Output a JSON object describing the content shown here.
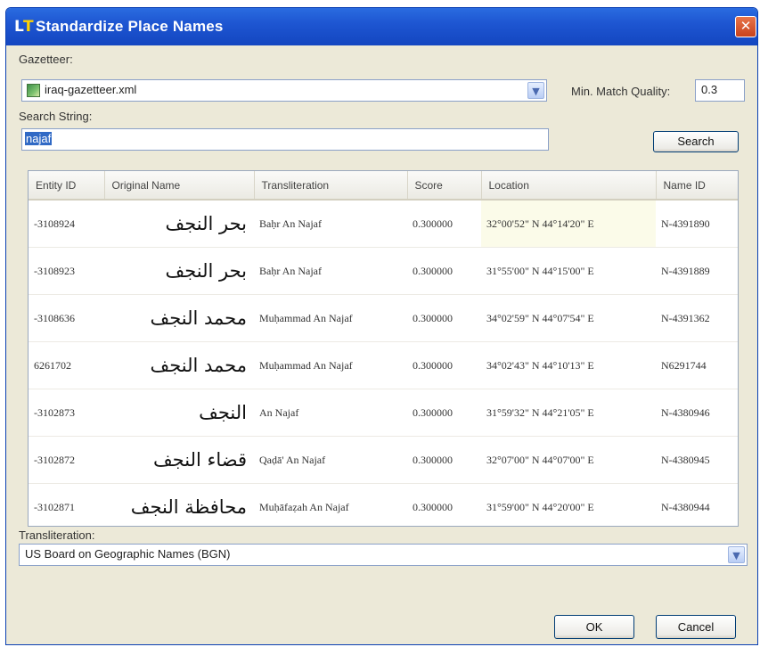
{
  "window": {
    "title": "Standardize Place Names",
    "icon_l": "L",
    "icon_t": "T",
    "close_glyph": "✕"
  },
  "gazetteer": {
    "label": "Gazetteer:",
    "value": "iraq-gazetteer.xml",
    "icon": "map-file-icon"
  },
  "min_match": {
    "label": "Min. Match Quality:",
    "value": "0.3"
  },
  "search": {
    "label": "Search String:",
    "value": "najaf",
    "button": "Search"
  },
  "table": {
    "columns": [
      "Entity ID",
      "Original Name",
      "Transliteration",
      "Score",
      "Location",
      "Name ID"
    ],
    "rows": [
      {
        "entity_id": "-3108924",
        "original": "بحر النجف",
        "translit": "Baḥr An Najaf",
        "score": "0.300000",
        "location": "32°00'52\" N 44°14'20\" E",
        "name_id": "N-4391890"
      },
      {
        "entity_id": "-3108923",
        "original": "بحر النجف",
        "translit": "Baḥr An Najaf",
        "score": "0.300000",
        "location": "31°55'00\" N 44°15'00\" E",
        "name_id": "N-4391889"
      },
      {
        "entity_id": "-3108636",
        "original": "محمد النجف",
        "translit": "Muḥammad An Najaf",
        "score": "0.300000",
        "location": "34°02'59\" N 44°07'54\" E",
        "name_id": "N-4391362"
      },
      {
        "entity_id": "6261702",
        "original": "محمد النجف",
        "translit": "Muḥammad An Najaf",
        "score": "0.300000",
        "location": "34°02'43\" N 44°10'13\" E",
        "name_id": "N6291744"
      },
      {
        "entity_id": "-3102873",
        "original": "النجف",
        "translit": "An Najaf",
        "score": "0.300000",
        "location": "31°59'32\" N 44°21'05\" E",
        "name_id": "N-4380946"
      },
      {
        "entity_id": "-3102872",
        "original": "قضاء النجف",
        "translit": "Qaḍā' An Najaf",
        "score": "0.300000",
        "location": "32°07'00\" N 44°07'00\" E",
        "name_id": "N-4380945"
      },
      {
        "entity_id": "-3102871",
        "original": "محافظة النجف",
        "translit": "Muḥāfaẓah An Najaf",
        "score": "0.300000",
        "location": "31°59'00\" N 44°20'00\" E",
        "name_id": "N-4380944"
      }
    ]
  },
  "transliteration": {
    "label": "Transliteration:",
    "value": "US Board on Geographic Names (BGN)"
  },
  "buttons": {
    "ok": "OK",
    "cancel": "Cancel"
  },
  "colors": {
    "title_bar": "#1e56d2",
    "dialog_bg": "#ece9d8",
    "selection": "#316ac5",
    "close_button": "#d8532b"
  }
}
